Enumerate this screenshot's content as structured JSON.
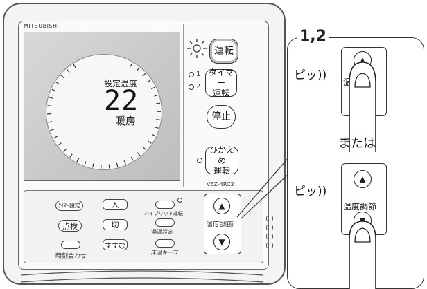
{
  "brand": "MITSUBISHI",
  "display": {
    "set_temp_label": "設定温度",
    "set_temp_value": "22",
    "mode_label": "暖房"
  },
  "right_panel": {
    "run_button": "運転",
    "timer_run_button_line1": "タイマー",
    "timer_run_button_line2": "運転",
    "stop_button": "停止",
    "eco_run_button_line1": "ひかえめ",
    "eco_run_button_line2": "運転",
    "timer_led_1": "1",
    "timer_led_2": "2",
    "model": "VEZ-4RC2"
  },
  "bottom_panel": {
    "timer_set_label": "ﾀｲﾏｰ設定",
    "on_button": "入",
    "off_button": "切",
    "inspect_button": "点検",
    "advance_button": "すすむ",
    "clock_label": "時刻合わせ",
    "hybrid_label": "ハイブリッド運転",
    "temp_set_label": "湯温設定",
    "floor_keep_label": "床温キープ",
    "temp_adjust_label": "温度調節",
    "up_arrow": "▲",
    "down_arrow": "▼"
  },
  "callout": {
    "step": "1,2",
    "beep_top": "ピッ))",
    "beep_bottom": "ピッ))",
    "or_text": "または",
    "key_label_top": "温度調節",
    "key_label_bottom": "温度調節",
    "up_arrow": "▲",
    "down_arrow": "▼"
  }
}
